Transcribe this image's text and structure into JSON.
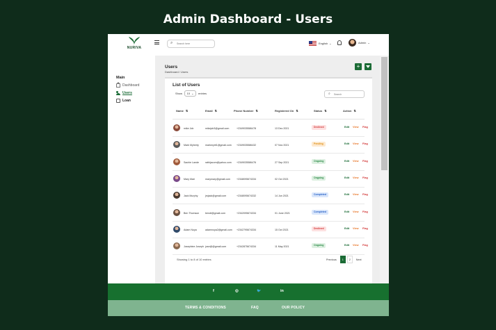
{
  "page_heading": "Admin Dashboard - Users",
  "topbar": {
    "logo_text": "NURIVA",
    "search_placeholder": "Search here",
    "language": "English",
    "admin_label": "Admin"
  },
  "sidebar": {
    "section": "Main",
    "items": [
      {
        "label": "Dashboard",
        "icon": "home-icon",
        "active": false
      },
      {
        "label": "Users",
        "icon": "users-icon",
        "active": true
      },
      {
        "label": "Loan",
        "icon": "loan-icon",
        "active": false
      }
    ]
  },
  "main": {
    "title": "Users",
    "breadcrumb": "Dashboard / Users",
    "add_label": "+",
    "card_title": "List of Users",
    "show_label": "Show",
    "entries_value": "10",
    "entries_label": "entries",
    "search_placeholder": "Search"
  },
  "table": {
    "columns": [
      "Name",
      "Email",
      "Phone Number",
      "Registered On",
      "Status",
      "Action"
    ],
    "rows": [
      {
        "name": "mike Job",
        "email": "mikejob3@gmail.com",
        "phone": "+2349035586478",
        "registered": "13 Dec 2021",
        "status": "Declined",
        "avatar": "#8a4a3a"
      },
      {
        "name": "Mark Myherty",
        "email": "markmyrti1@gmail.com",
        "phone": "+2349035586432",
        "registered": "07 Nov 2021",
        "status": "Pending",
        "avatar": "#5a5a5a"
      },
      {
        "name": "Sachie Lande",
        "email": "rathijacom@yahoo.com",
        "phone": "+2349035586476",
        "registered": "27 Sep 2021",
        "status": "Ongoing",
        "avatar": "#a05a3a"
      },
      {
        "name": "Mary Mari",
        "email": "marymary@gmail.com",
        "phone": "+2348095674334",
        "registered": "02 Oct 2021",
        "status": "Ongoing",
        "avatar": "#7a4a8a"
      },
      {
        "name": "Jack Murphy",
        "email": "jmjack@gmail.com",
        "phone": "+2348095674332",
        "registered": "14 Jun 2021",
        "status": "Completed",
        "avatar": "#4a3a30"
      },
      {
        "name": "Ben Thomson",
        "email": "bendt@gmail.com",
        "phone": "+2342095674334",
        "registered": "01 June 2021",
        "status": "Completed",
        "avatar": "#6a5040"
      },
      {
        "name": "Adam Noya",
        "email": "adamnoya2@gmail.com",
        "phone": "+2342795674334",
        "registered": "15 Oct 2021",
        "status": "Declined",
        "avatar": "#304a6a"
      },
      {
        "name": "Josephine Joseph",
        "email": "jose@@gmail.com",
        "phone": "+2342875674334",
        "registered": "11 May 2021",
        "status": "Ongoing",
        "avatar": "#8a6a50"
      }
    ],
    "actions": {
      "edit": "Edit",
      "view": "View",
      "flag": "Flag"
    }
  },
  "pagination": {
    "info": "Showing 1 to 8 of 10 entries",
    "previous": "Previous",
    "pages": [
      "1",
      "2"
    ],
    "next": "Next"
  },
  "footer": {
    "social": [
      "f",
      "◎",
      "🐦",
      "in"
    ],
    "links": [
      "TERMS & CONDITIONS",
      "FAQ",
      "OUR POLICY"
    ]
  },
  "colors": {
    "background": "#0f2c1b",
    "brand_green": "#17702f",
    "footer_light": "#7fb48f",
    "declined_bg": "#fde0e0",
    "declined_fg": "#d33a3a",
    "pending_bg": "#fde9cf",
    "pending_fg": "#e0921a",
    "ongoing_bg": "#dcefe0",
    "ongoing_fg": "#2a8a46",
    "completed_bg": "#d9e6fb",
    "completed_fg": "#2a63c7",
    "edit": "#1b6b35",
    "view": "#e8762a",
    "flag": "#d33a3a"
  }
}
